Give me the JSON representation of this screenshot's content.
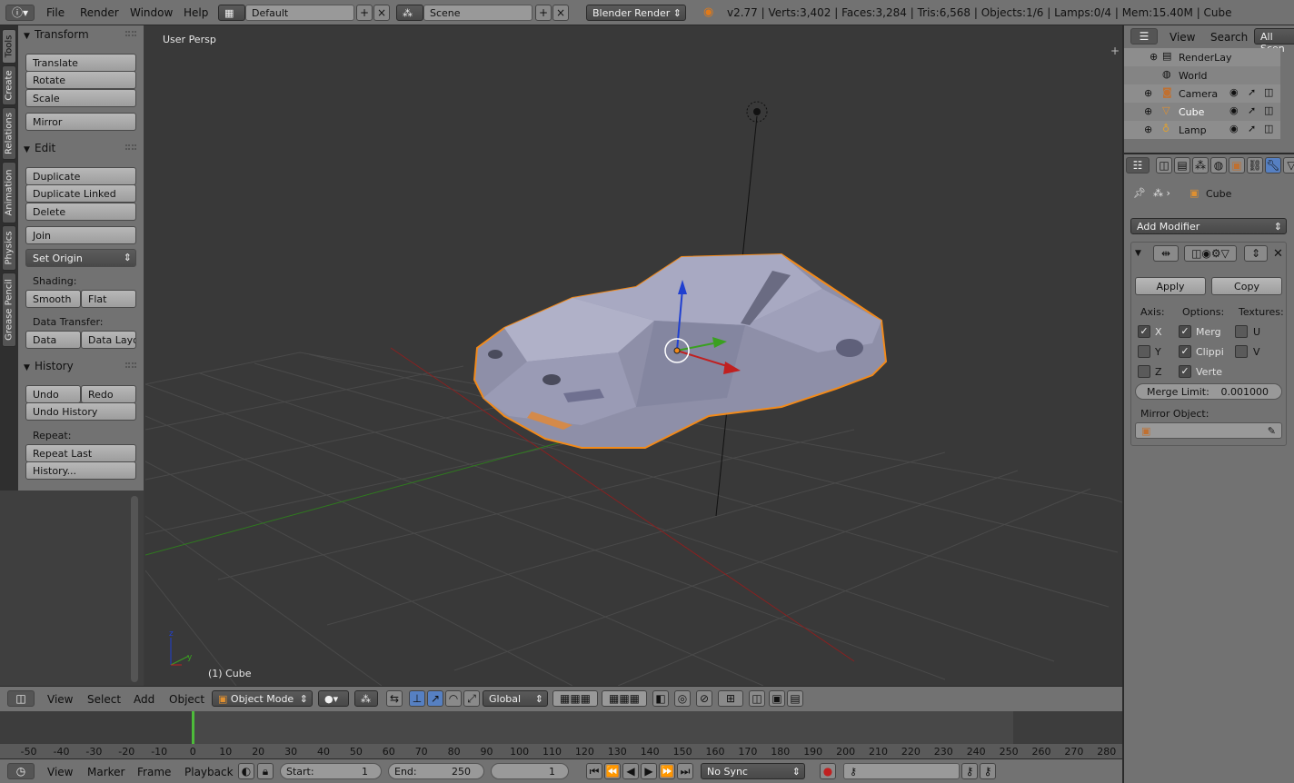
{
  "topbar": {
    "menus": [
      "File",
      "Render",
      "Window",
      "Help"
    ],
    "screen_layout": "Default",
    "scene": "Scene",
    "render_engine": "Blender Render",
    "status": "v2.77 | Verts:3,402 | Faces:3,284 | Tris:6,568 | Objects:1/6 | Lamps:0/4 | Mem:15.40M | Cube"
  },
  "tabs": [
    "Tools",
    "Create",
    "Relations",
    "Animation",
    "Physics",
    "Grease Pencil"
  ],
  "toolshelf": {
    "transform_title": "Transform",
    "translate": "Translate",
    "rotate": "Rotate",
    "scale": "Scale",
    "mirror": "Mirror",
    "edit_title": "Edit",
    "duplicate": "Duplicate",
    "duplicate_linked": "Duplicate Linked",
    "delete": "Delete",
    "join": "Join",
    "set_origin": "Set Origin",
    "shading_label": "Shading:",
    "smooth": "Smooth",
    "flat": "Flat",
    "data_transfer_label": "Data Transfer:",
    "data": "Data",
    "data_layo": "Data Layo",
    "history_title": "History",
    "undo": "Undo",
    "redo": "Redo",
    "undo_history": "Undo History",
    "repeat_label": "Repeat:",
    "repeat_last": "Repeat Last",
    "history_btn": "History..."
  },
  "viewport": {
    "view_label": "User Persp",
    "object_label": "(1) Cube"
  },
  "viewport_header": {
    "menus": [
      "View",
      "Select",
      "Add",
      "Object"
    ],
    "mode": "Object Mode",
    "orientation": "Global"
  },
  "timeline": {
    "ticks": [
      "-50",
      "-40",
      "-30",
      "-20",
      "-10",
      "0",
      "10",
      "20",
      "30",
      "40",
      "50",
      "60",
      "70",
      "80",
      "90",
      "100",
      "110",
      "120",
      "130",
      "140",
      "150",
      "160",
      "170",
      "180",
      "190",
      "200",
      "210",
      "220",
      "230",
      "240",
      "250",
      "260",
      "270",
      "280"
    ],
    "menus": [
      "View",
      "Marker",
      "Frame",
      "Playback"
    ],
    "start_label": "Start:",
    "start_value": "1",
    "end_label": "End:",
    "end_value": "250",
    "current_frame": "1",
    "sync": "No Sync"
  },
  "outliner": {
    "menus": [
      "View",
      "Search"
    ],
    "filter": "All Scen",
    "items": [
      "RenderLay",
      "World",
      "Camera",
      "Cube",
      "Lamp"
    ]
  },
  "properties": {
    "object_name": "Cube",
    "add_modifier": "Add Modifier",
    "apply": "Apply",
    "copy": "Copy",
    "axis_label": "Axis:",
    "options_label": "Options:",
    "textures_label": "Textures:",
    "axis_x": "X",
    "axis_y": "Y",
    "axis_z": "Z",
    "opt_merge": "Merg",
    "opt_clip": "Clippi",
    "opt_vert": "Verte",
    "tex_u": "U",
    "tex_v": "V",
    "merge_limit_label": "Merge Limit:",
    "merge_limit_value": "0.001000",
    "mirror_object_label": "Mirror Object:"
  },
  "colors": {
    "panel": "#727272",
    "viewport_bg": "#393939",
    "selection_outline": "#f28a1a",
    "x_axis": "#b02020",
    "y_axis": "#3a9a20",
    "z_axis": "#2040d0"
  }
}
